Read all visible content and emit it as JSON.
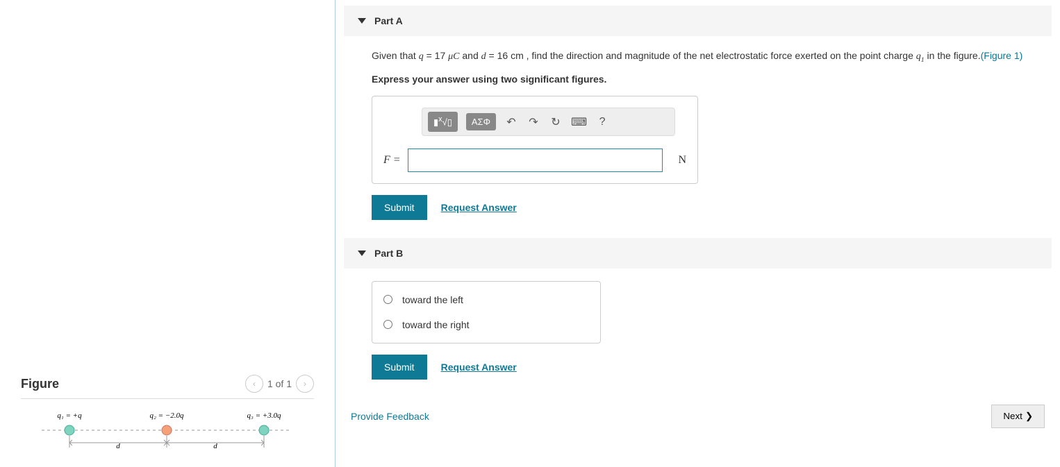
{
  "figure": {
    "title": "Figure",
    "nav": "1 of 1",
    "labels": {
      "q1": "q₁ = +q",
      "q2": "q₂ = −2.0q",
      "q3": "q₃ = +3.0q",
      "dist": "d"
    }
  },
  "partA": {
    "title": "Part A",
    "question_pre": "Given that ",
    "q_var": "q",
    "q_val": " = 17 ",
    "q_unit": "μC",
    "and": " and ",
    "d_var": "d",
    "d_val": " = 16 ",
    "d_unit": "cm",
    "question_post": " , find the direction and magnitude of the net electrostatic force exerted on the point charge ",
    "q1_html": "q₁",
    "question_end": " in the figure.",
    "figlink": "(Figure 1)",
    "instruction": "Express your answer using two significant figures.",
    "toolbar": {
      "templates": "√",
      "greek": "ΑΣΦ",
      "undo": "↶",
      "redo": "↷",
      "reset": "↻",
      "keyboard": "⌨",
      "help": "?"
    },
    "F_label": "F =",
    "unit": "N",
    "submit": "Submit",
    "request": "Request Answer"
  },
  "partB": {
    "title": "Part B",
    "opt1": "toward the left",
    "opt2": "toward the right",
    "submit": "Submit",
    "request": "Request Answer"
  },
  "footer": {
    "feedback": "Provide Feedback",
    "next": "Next"
  }
}
